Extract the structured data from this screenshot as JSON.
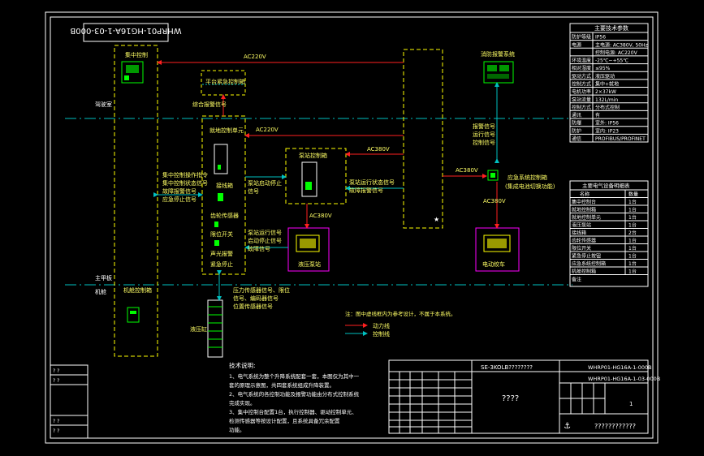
{
  "title_block_vertical": "WHRP01-HG16A-1-03-000B",
  "zones": {
    "upper": "驾驶室",
    "mid": "主甲板",
    "lower": "机舱"
  },
  "boxes": {
    "central_console": "集中控制",
    "platform_terminal": "平台紧急控制箱",
    "local_controller": "就地控制单元",
    "switch_box": "接线箱",
    "gear_encoder": "齿轮传感器",
    "limit_switch": "限位开关",
    "sound_light": "声光报警",
    "emergency_stop": "紧急停止",
    "hydraulic_starter": "泵站控制箱",
    "hydraulic_unit": "液压泵站",
    "drive_unit": "电动绞车",
    "engine_room_box": "机舱控制箱",
    "rack": "液压缸",
    "emergency_box": "应急系统控制箱",
    "emergency_box_note": "(集成电池切换功能)",
    "fire_panel": "消防报警系统",
    "fire_panel_sub": "报警信号"
  },
  "signals": {
    "ac220v_top": "AC220V",
    "ac220v_mid": "AC220V",
    "ac380v_a": "AC380V",
    "ac380v_b": "AC380V",
    "ac380v_c": "AC380V",
    "ac380v_d": "AC380V",
    "reset_signal": "综合报警信号",
    "left_signals": "集中控制操作指令\n集中控制状态信号\n故障报警信号\n应急停止信号",
    "mid_signals": "泵站启动停止\n信号",
    "mid_signals2": "泵站运行状态信号\n故障报警信号",
    "pump_signals": "泵站运行信号\n启动停止信号\n故障信号",
    "right_signals": "报警信号\n运行信号\n控制信号",
    "bottom_signals": "压力传感器信号、限位\n信号、编码器信号\n位置传感器信号"
  },
  "legend": {
    "note": "注：图中虚线框内为参考设计，不属于本系统。",
    "power": "动力线",
    "control": "控制线"
  },
  "tech_params": {
    "title": "主要技术参数",
    "rows": [
      [
        "防护等级",
        "IP56"
      ],
      [
        "电源",
        "主电源: AC380V, 50Hz"
      ],
      [
        "",
        "控制电源: AC220V"
      ],
      [
        "环境温度",
        "-25℃~+55℃"
      ],
      [
        "相对湿度",
        "≤95%"
      ],
      [
        "驱动方式",
        "液压驱动"
      ],
      [
        "控制方式",
        "集中+就地"
      ],
      [
        "电机功率",
        "2×37kW"
      ],
      [
        "泵站流量",
        "132L/min"
      ],
      [
        "控制方式",
        "分布式控制"
      ],
      [
        "通讯",
        "有"
      ],
      [
        "防爆",
        "室外: IP56"
      ],
      [
        "防护",
        "室内: IP23"
      ],
      [
        "通信",
        "PROFIBUS/PROFINET"
      ]
    ]
  },
  "equipment": {
    "title": "主要电气设备明细表",
    "head": [
      "名称",
      "数量"
    ],
    "rows": [
      [
        "集中控制台",
        "1台"
      ],
      [
        "就地控制箱",
        "1台"
      ],
      [
        "就地控制单元",
        "1台"
      ],
      [
        "液压泵站",
        "1台"
      ],
      [
        "接线箱",
        "2台"
      ],
      [
        "齿轮传感器",
        "1台"
      ],
      [
        "限位开关",
        "1台"
      ],
      [
        "紧急停止按钮",
        "1台"
      ],
      [
        "应急系统控制箱",
        "1台"
      ],
      [
        "机舱控制箱",
        "1台"
      ]
    ],
    "footer": "备注"
  },
  "notes": {
    "title": "技术说明:",
    "lines": [
      "1、电气系统为整个升降系统配套一套，本图仅为其中一",
      "套的原理示意图，共四套系统组成升降装置。",
      "2、电气系统的各控制功能及报警功能由分布式控制系统",
      "完成实现。",
      "3、集中控制台配置1台，执行控制器、驱动控制单元、",
      "检测传感器等按设计配置，且系统具备冗余配置",
      "功能。"
    ]
  },
  "title_block": {
    "drawing_no_1": "SE-3KOLB????????",
    "drawing_no_2": "WHRP01-HG16A-1-000B",
    "drawing_no_3": "WHRP01-HG16A-1-03-000B",
    "name": "????",
    "company": "????????????",
    "sheet": "1"
  },
  "side_block": [
    "? ?",
    "? ?",
    "? ?",
    "? ?"
  ],
  "colors": {
    "frame": "#ffffff",
    "dashed": "#ffff00",
    "power": "#ff2020",
    "control": "#00c0c0",
    "device": "#ff00ff",
    "text": "#ffff66",
    "green": "#00ff00"
  }
}
